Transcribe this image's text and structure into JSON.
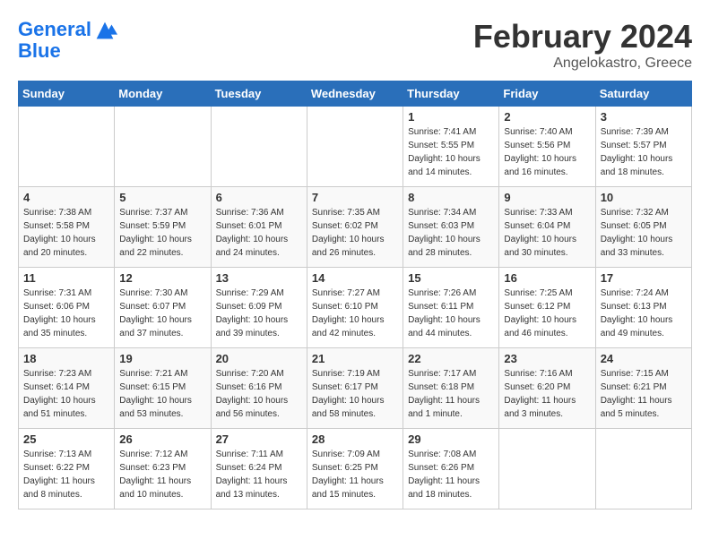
{
  "header": {
    "logo_line1": "General",
    "logo_line2": "Blue",
    "month_year": "February 2024",
    "location": "Angelokastro, Greece"
  },
  "days_of_week": [
    "Sunday",
    "Monday",
    "Tuesday",
    "Wednesday",
    "Thursday",
    "Friday",
    "Saturday"
  ],
  "weeks": [
    [
      {
        "day": "",
        "info": ""
      },
      {
        "day": "",
        "info": ""
      },
      {
        "day": "",
        "info": ""
      },
      {
        "day": "",
        "info": ""
      },
      {
        "day": "1",
        "info": "Sunrise: 7:41 AM\nSunset: 5:55 PM\nDaylight: 10 hours\nand 14 minutes."
      },
      {
        "day": "2",
        "info": "Sunrise: 7:40 AM\nSunset: 5:56 PM\nDaylight: 10 hours\nand 16 minutes."
      },
      {
        "day": "3",
        "info": "Sunrise: 7:39 AM\nSunset: 5:57 PM\nDaylight: 10 hours\nand 18 minutes."
      }
    ],
    [
      {
        "day": "4",
        "info": "Sunrise: 7:38 AM\nSunset: 5:58 PM\nDaylight: 10 hours\nand 20 minutes."
      },
      {
        "day": "5",
        "info": "Sunrise: 7:37 AM\nSunset: 5:59 PM\nDaylight: 10 hours\nand 22 minutes."
      },
      {
        "day": "6",
        "info": "Sunrise: 7:36 AM\nSunset: 6:01 PM\nDaylight: 10 hours\nand 24 minutes."
      },
      {
        "day": "7",
        "info": "Sunrise: 7:35 AM\nSunset: 6:02 PM\nDaylight: 10 hours\nand 26 minutes."
      },
      {
        "day": "8",
        "info": "Sunrise: 7:34 AM\nSunset: 6:03 PM\nDaylight: 10 hours\nand 28 minutes."
      },
      {
        "day": "9",
        "info": "Sunrise: 7:33 AM\nSunset: 6:04 PM\nDaylight: 10 hours\nand 30 minutes."
      },
      {
        "day": "10",
        "info": "Sunrise: 7:32 AM\nSunset: 6:05 PM\nDaylight: 10 hours\nand 33 minutes."
      }
    ],
    [
      {
        "day": "11",
        "info": "Sunrise: 7:31 AM\nSunset: 6:06 PM\nDaylight: 10 hours\nand 35 minutes."
      },
      {
        "day": "12",
        "info": "Sunrise: 7:30 AM\nSunset: 6:07 PM\nDaylight: 10 hours\nand 37 minutes."
      },
      {
        "day": "13",
        "info": "Sunrise: 7:29 AM\nSunset: 6:09 PM\nDaylight: 10 hours\nand 39 minutes."
      },
      {
        "day": "14",
        "info": "Sunrise: 7:27 AM\nSunset: 6:10 PM\nDaylight: 10 hours\nand 42 minutes."
      },
      {
        "day": "15",
        "info": "Sunrise: 7:26 AM\nSunset: 6:11 PM\nDaylight: 10 hours\nand 44 minutes."
      },
      {
        "day": "16",
        "info": "Sunrise: 7:25 AM\nSunset: 6:12 PM\nDaylight: 10 hours\nand 46 minutes."
      },
      {
        "day": "17",
        "info": "Sunrise: 7:24 AM\nSunset: 6:13 PM\nDaylight: 10 hours\nand 49 minutes."
      }
    ],
    [
      {
        "day": "18",
        "info": "Sunrise: 7:23 AM\nSunset: 6:14 PM\nDaylight: 10 hours\nand 51 minutes."
      },
      {
        "day": "19",
        "info": "Sunrise: 7:21 AM\nSunset: 6:15 PM\nDaylight: 10 hours\nand 53 minutes."
      },
      {
        "day": "20",
        "info": "Sunrise: 7:20 AM\nSunset: 6:16 PM\nDaylight: 10 hours\nand 56 minutes."
      },
      {
        "day": "21",
        "info": "Sunrise: 7:19 AM\nSunset: 6:17 PM\nDaylight: 10 hours\nand 58 minutes."
      },
      {
        "day": "22",
        "info": "Sunrise: 7:17 AM\nSunset: 6:18 PM\nDaylight: 11 hours\nand 1 minute."
      },
      {
        "day": "23",
        "info": "Sunrise: 7:16 AM\nSunset: 6:20 PM\nDaylight: 11 hours\nand 3 minutes."
      },
      {
        "day": "24",
        "info": "Sunrise: 7:15 AM\nSunset: 6:21 PM\nDaylight: 11 hours\nand 5 minutes."
      }
    ],
    [
      {
        "day": "25",
        "info": "Sunrise: 7:13 AM\nSunset: 6:22 PM\nDaylight: 11 hours\nand 8 minutes."
      },
      {
        "day": "26",
        "info": "Sunrise: 7:12 AM\nSunset: 6:23 PM\nDaylight: 11 hours\nand 10 minutes."
      },
      {
        "day": "27",
        "info": "Sunrise: 7:11 AM\nSunset: 6:24 PM\nDaylight: 11 hours\nand 13 minutes."
      },
      {
        "day": "28",
        "info": "Sunrise: 7:09 AM\nSunset: 6:25 PM\nDaylight: 11 hours\nand 15 minutes."
      },
      {
        "day": "29",
        "info": "Sunrise: 7:08 AM\nSunset: 6:26 PM\nDaylight: 11 hours\nand 18 minutes."
      },
      {
        "day": "",
        "info": ""
      },
      {
        "day": "",
        "info": ""
      }
    ]
  ]
}
